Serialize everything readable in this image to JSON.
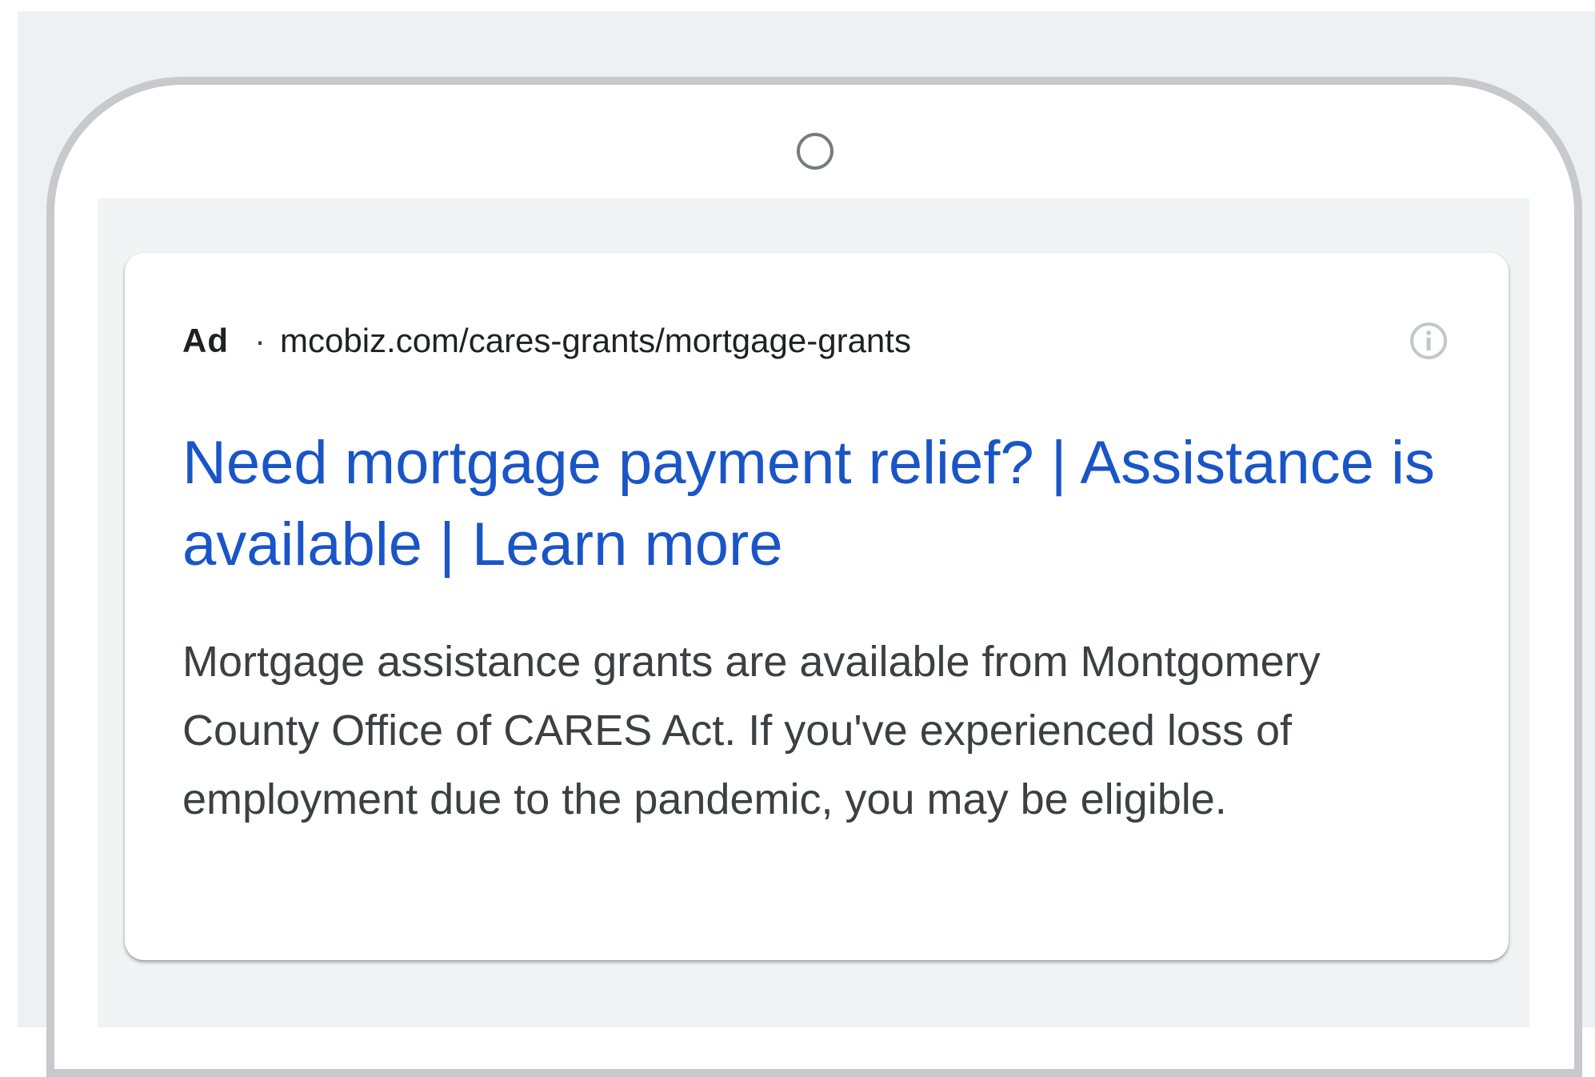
{
  "ad": {
    "label": "Ad",
    "separator": "·",
    "display_url": "mcobiz.com/cares-grants/mortgage-grants",
    "info_icon": "info-circle-icon",
    "headline": "Need mortgage payment relief? | Assistance is available | Learn more",
    "description": "Mortgage assistance grants are available from Montgomery County Office of CARES Act. If you've experienced loss of employment due to the pandemic, you may be eligible."
  },
  "colors": {
    "headline": "#1a55c8",
    "body_text": "#3c4043",
    "page_background": "#eef1f4",
    "phone_frame": "#c7c9cc"
  }
}
